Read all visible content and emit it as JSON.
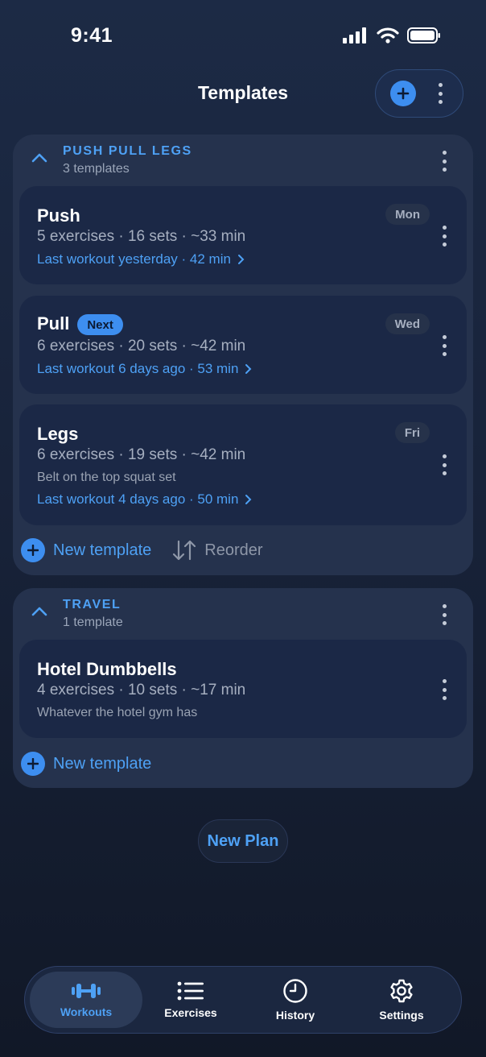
{
  "status": {
    "time": "9:41"
  },
  "header": {
    "title": "Templates"
  },
  "groups": [
    {
      "name": "PUSH PULL LEGS",
      "count": "3 templates",
      "templates": [
        {
          "title": "Push",
          "meta": "5 exercises · 16 sets · ~33 min",
          "last": "Last workout yesterday · 42 min",
          "day": "Mon"
        },
        {
          "title": "Pull",
          "badge": "Next",
          "meta": "6 exercises · 20 sets · ~42 min",
          "last": "Last workout 6 days ago · 53 min",
          "day": "Wed"
        },
        {
          "title": "Legs",
          "meta": "6 exercises · 19 sets · ~42 min",
          "note": "Belt on the top squat set",
          "last": "Last workout 4 days ago · 50 min",
          "day": "Fri"
        }
      ],
      "new_template": "New template",
      "reorder": "Reorder"
    },
    {
      "name": "TRAVEL",
      "count": "1 template",
      "templates": [
        {
          "title": "Hotel Dumbbells",
          "meta": "4 exercises · 10 sets · ~17 min",
          "note": "Whatever the hotel gym has"
        }
      ],
      "new_template": "New template"
    }
  ],
  "new_plan": "New Plan",
  "tabs": [
    {
      "label": "Workouts",
      "icon": "dumbbell-icon",
      "active": true
    },
    {
      "label": "Exercises",
      "icon": "list-icon"
    },
    {
      "label": "History",
      "icon": "clock-icon"
    },
    {
      "label": "Settings",
      "icon": "gear-icon"
    }
  ],
  "colors": {
    "accent": "#3d8ef0",
    "link": "#4ea1f5",
    "background": "#18233a",
    "card": "#1b2846",
    "group": "#25324d"
  }
}
